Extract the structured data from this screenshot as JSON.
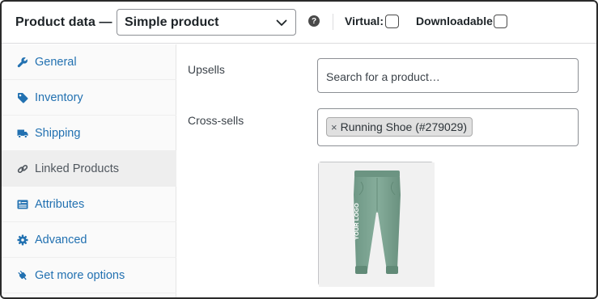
{
  "header": {
    "title": "Product data —",
    "product_type": "Simple product",
    "help": "?",
    "virtual_label": "Virtual:",
    "downloadable_label": "Downloadable:",
    "virtual_checked": false,
    "downloadable_checked": false
  },
  "tabs": [
    {
      "label": "General",
      "icon": "wrench-icon",
      "active": false
    },
    {
      "label": "Inventory",
      "icon": "tag-icon",
      "active": false
    },
    {
      "label": "Shipping",
      "icon": "truck-icon",
      "active": false
    },
    {
      "label": "Linked Products",
      "icon": "link-icon",
      "active": true
    },
    {
      "label": "Attributes",
      "icon": "list-icon",
      "active": false
    },
    {
      "label": "Advanced",
      "icon": "gear-icon",
      "active": false
    },
    {
      "label": "Get more options",
      "icon": "plugin-icon",
      "active": false
    }
  ],
  "upsells": {
    "label": "Upsells",
    "placeholder": "Search for a product…"
  },
  "cross_sells": {
    "label": "Cross-sells",
    "remove_glyph": "×",
    "selected": "Running Shoe (#279029)"
  },
  "product_image": {
    "logo_text": "YOUR LOGO",
    "product_color": "#7fa695"
  },
  "colors": {
    "link": "#2271b1",
    "active_tab_text": "#50575e",
    "border": "#8c8f94"
  }
}
